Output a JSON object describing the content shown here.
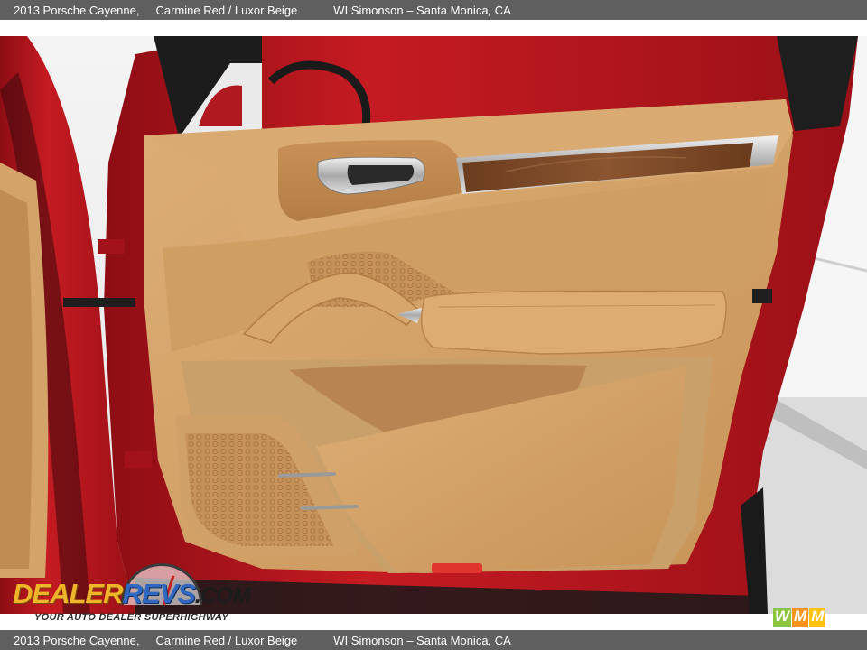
{
  "header": {
    "vehicle": "2013 Porsche Cayenne,",
    "colors": "Carmine Red / Luxor Beige",
    "dealer": "WI Simonson – Santa Monica, CA"
  },
  "footer": {
    "vehicle": "2013 Porsche Cayenne,",
    "colors": "Carmine Red / Luxor Beige",
    "dealer": "WI Simonson – Santa Monica, CA"
  },
  "watermark": {
    "logo_part1": "DEALER",
    "logo_part2": "REVS",
    "logo_part3": ".COM",
    "tagline": "YOUR AUTO DEALER SUPERHIGHWAY",
    "gauge_icon": "speedometer-icon"
  },
  "corner_logo": {
    "letters": [
      "W",
      "M",
      "M"
    ],
    "colors": [
      "#8cc63f",
      "#f7941d",
      "#ffc20e"
    ]
  },
  "colors": {
    "exterior": "#b5161e",
    "interior": "#d6a66e",
    "wood": "#7a4a28",
    "bar": "#5f5f5f"
  }
}
